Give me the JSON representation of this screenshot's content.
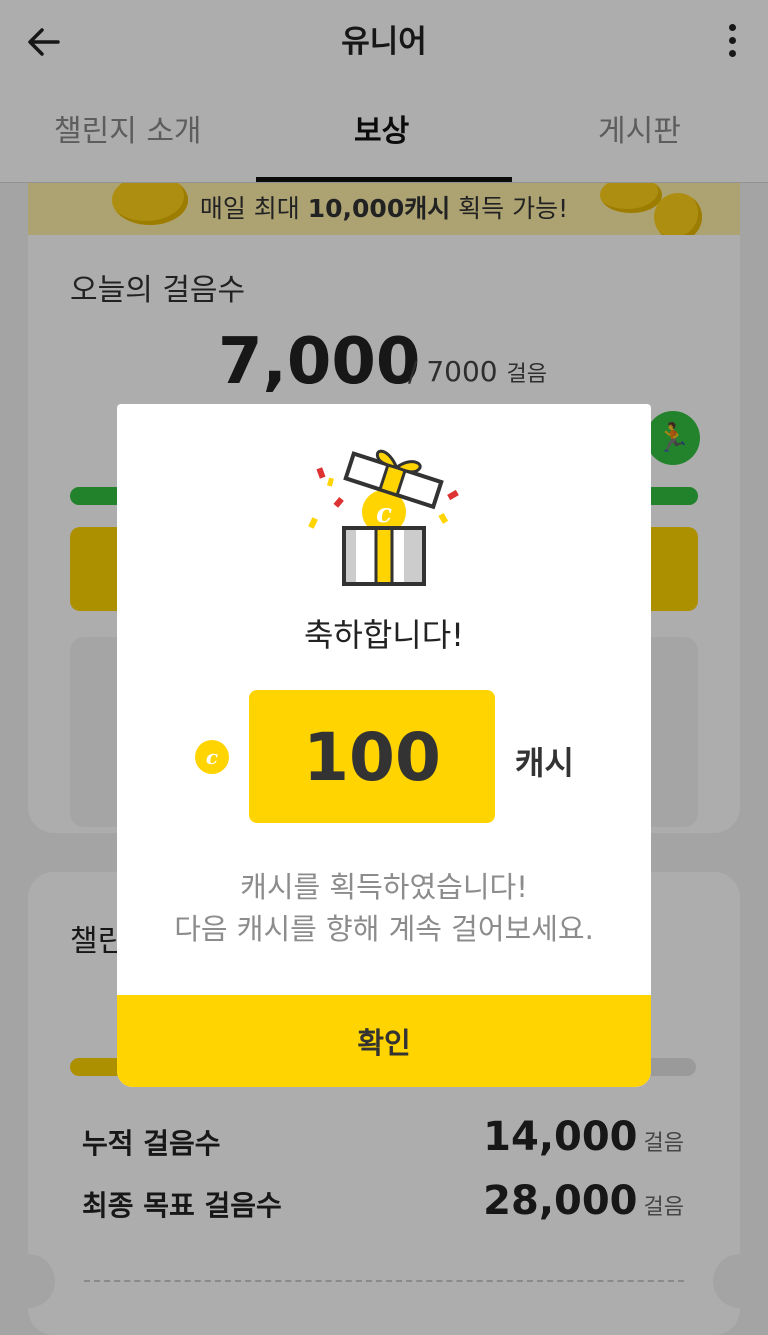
{
  "header": {
    "title": "유니어"
  },
  "tabs": [
    {
      "label": "챌린지 소개"
    },
    {
      "label": "보상"
    },
    {
      "label": "게시판"
    }
  ],
  "banner": {
    "prefix": "매일 최대 ",
    "highlight": "10,000캐시",
    "suffix": " 획득 가능!"
  },
  "today": {
    "title": "오늘의 걸음수",
    "steps": "7,000",
    "goal": "/ 7000",
    "unit": "걸음",
    "progress": 1.0
  },
  "challenge": {
    "title_fragment": "챌린",
    "progress": 0.5,
    "stats": [
      {
        "label": "누적 걸음수",
        "value": "14,000",
        "unit": "걸음"
      },
      {
        "label": "최종 목표 걸음수",
        "value": "28,000",
        "unit": "걸음"
      }
    ]
  },
  "modal": {
    "title": "축하합니다!",
    "coin_letter": "c",
    "amount": "100",
    "unit": "캐시",
    "message_line1": "캐시를 획득하였습니다!",
    "message_line2": "다음 캐시를 향해 계속 걸어보세요.",
    "confirm_label": "확인"
  },
  "colors": {
    "accent": "#ffd400",
    "progress_green": "#33c040",
    "dim_overlay": "rgba(0,0,0,0.32)"
  }
}
